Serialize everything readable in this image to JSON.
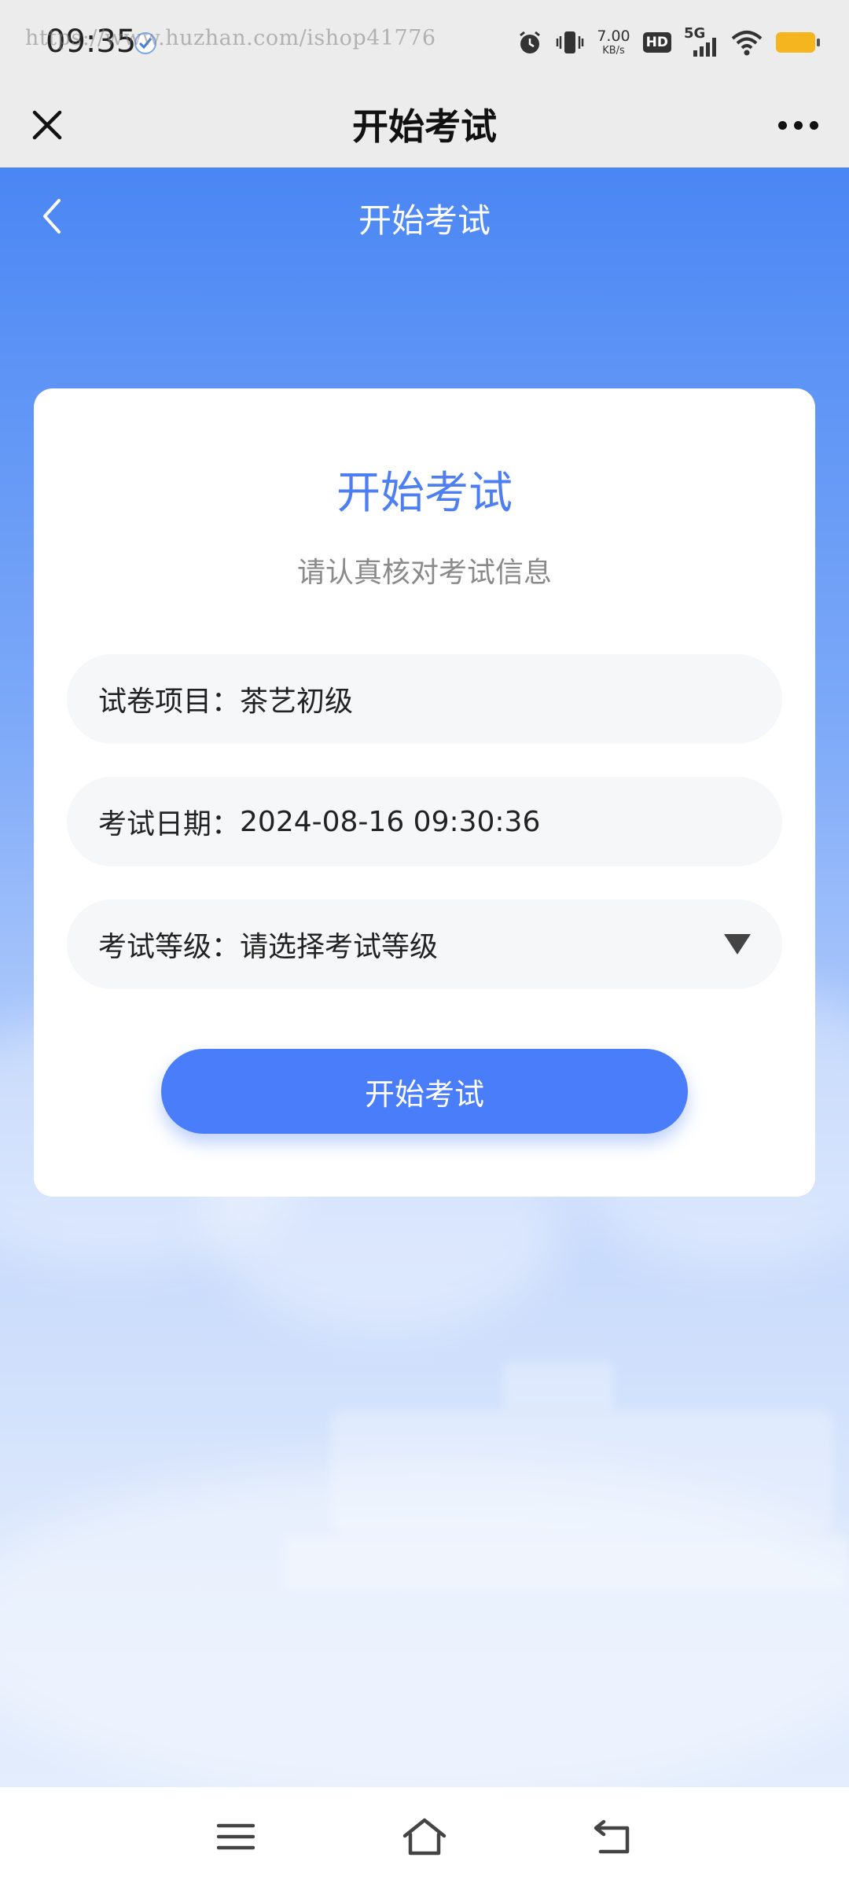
{
  "status_bar": {
    "time": "09:35",
    "watermark": "https://www.huzhan.com/ishop41776",
    "net_speed_value": "7.00",
    "net_speed_unit": "KB/s",
    "hd_label": "HD",
    "network_label": "5G",
    "icons": [
      "alarm-icon",
      "vibrate-icon",
      "signal-icon",
      "wifi-icon",
      "battery-icon"
    ],
    "battery_color": "#f5b51e"
  },
  "app_bar": {
    "title": "开始考试",
    "close_icon": "close-icon",
    "more_icon": "more-icon"
  },
  "inner_nav": {
    "title": "开始考试",
    "back_icon": "chevron-left-icon"
  },
  "card": {
    "title": "开始考试",
    "subtitle": "请认真核对考试信息",
    "fields": {
      "project": {
        "label": "试卷项目：",
        "value": "茶艺初级"
      },
      "date": {
        "label": "考试日期：",
        "value": "2024-08-16 09:30:36"
      },
      "level": {
        "label": "考试等级：",
        "value": "请选择考试等级"
      }
    },
    "start_button": "开始考试"
  },
  "colors": {
    "accent": "#4a7dfa",
    "title_blue": "#4d7ef2",
    "header_gray": "#ececec"
  },
  "system_nav": {
    "icons": [
      "menu-icon",
      "home-icon",
      "back-icon"
    ]
  }
}
